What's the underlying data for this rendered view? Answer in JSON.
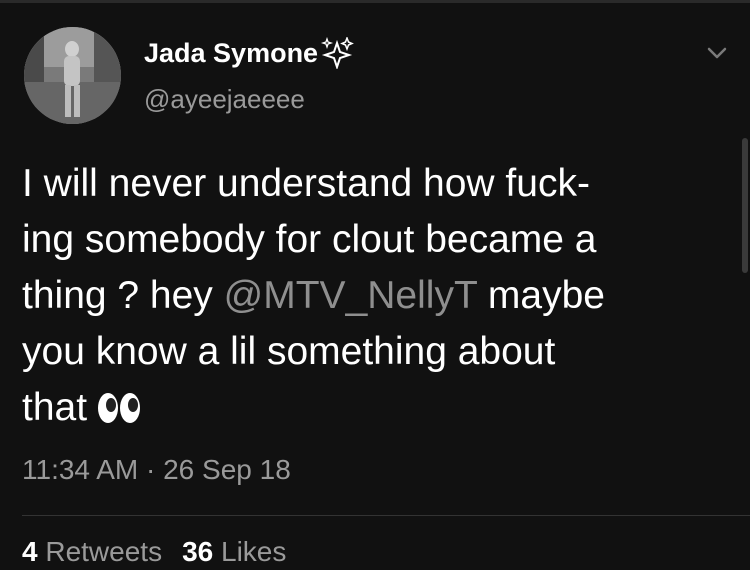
{
  "tweet": {
    "display_name": "Jada Symone",
    "handle": "@ayeejaeeee",
    "text": {
      "line1": "I will never understand how fuck-",
      "line2": "ing somebody for clout became a",
      "line3_before": "thing ? hey ",
      "mention": "@MTV_NellyT",
      "line3_after": " maybe",
      "line4": "you know a lil something about",
      "line5": "that"
    },
    "timestamp": "11:34 AM · 26 Sep 18",
    "stats": {
      "retweets_count": "4",
      "retweets_label": "Retweets",
      "likes_count": "36",
      "likes_label": "Likes"
    }
  },
  "icons": {
    "name_emoji": "sparkles-icon",
    "text_emoji": "eyes-icon",
    "menu": "chevron-down-icon"
  },
  "colors": {
    "background": "#111111",
    "text": "#ffffff",
    "secondary_text": "#9a9a9a",
    "mention": "#8f8f8f"
  }
}
